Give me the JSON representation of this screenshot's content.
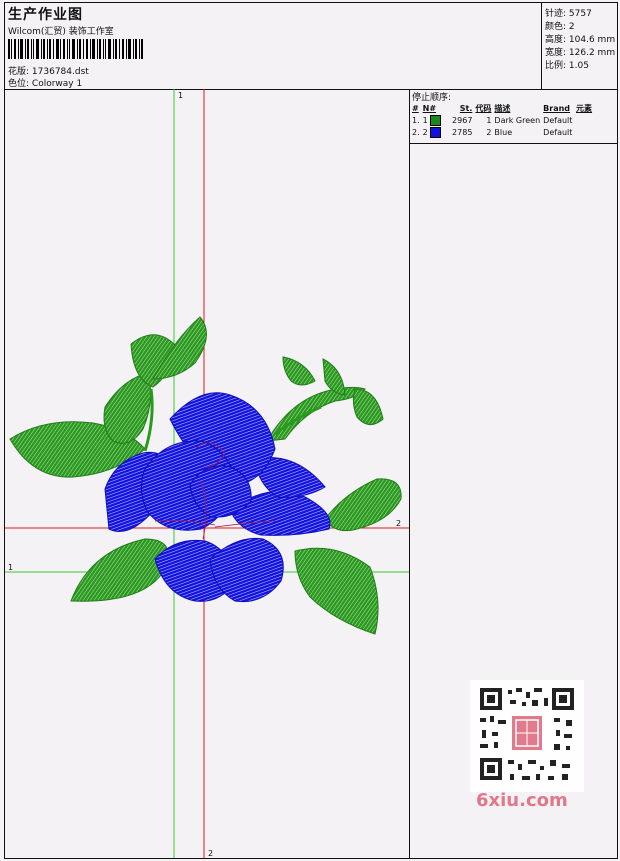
{
  "header": {
    "title": "生产作业图",
    "company": "Wilcom(汇贸) 装饰工作室",
    "pattern_label": "花版:",
    "pattern_value": "1736784.dst",
    "colorway_label": "色位:",
    "colorway_value": "Colorway 1"
  },
  "stats": {
    "stitches_label": "针迹:",
    "stitches_value": "5757",
    "colors_label": "颜色:",
    "colors_value": "2",
    "height_label": "高度:",
    "height_value": "104.6 mm",
    "width_label": "宽度:",
    "width_value": "126.2 mm",
    "scale_label": "比例:",
    "scale_value": "1.05"
  },
  "stop_sequence": {
    "title": "停止顺序:",
    "columns": [
      "#",
      "N#",
      "St.",
      "代码",
      "描述",
      "Brand",
      "元素"
    ],
    "rows": [
      {
        "num": "1.",
        "n": "1",
        "color": "#1a8a1a",
        "st": "2967",
        "code": "1",
        "desc": "Dark Green",
        "brand": "Default"
      },
      {
        "num": "2.",
        "n": "2",
        "color": "#1010e0",
        "st": "2785",
        "code": "2",
        "desc": "Blue",
        "brand": "Default"
      }
    ]
  },
  "guides": {
    "label_1": "1",
    "label_2": "2"
  },
  "watermark": {
    "text": "6xiu.com"
  },
  "colors": {
    "green_thread": "#2a9a1f",
    "blue_thread": "#1414e0",
    "green_guide": "#33cc33",
    "red_guide": "#dd1a1a"
  }
}
